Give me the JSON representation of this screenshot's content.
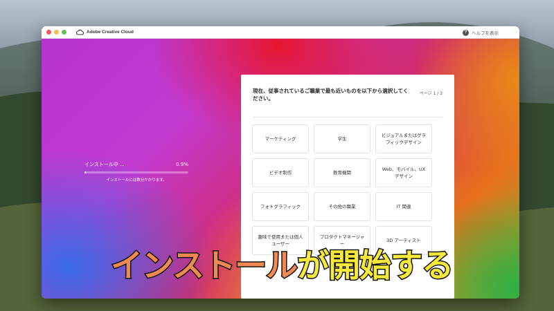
{
  "window": {
    "app_title": "Adobe Creative Cloud",
    "help_label": "ヘルプを表示"
  },
  "install": {
    "status_label": "インストール中 ...",
    "percent": "0.9%",
    "progress_fraction": 0.009,
    "note": "インストールには数分かかります。"
  },
  "survey": {
    "question": "現在、従事されているご職業で最も近いものを以下から選択してください。",
    "page_indicator": "ページ 1 / 3",
    "options": [
      "マーケティング",
      "学生",
      "ビジュアルまたはグラフィックデザイン",
      "ビデオ制作",
      "教育機関",
      "Web、モバイル、UX デザイン",
      "フォトグラフィック",
      "その他の職業",
      "IT 関連",
      "趣味で使用または個人ユーザー",
      "プロダクトマネージャー",
      "3D アーティスト"
    ]
  },
  "caption": {
    "part1": "インストール",
    "part2": "が開始する"
  },
  "colors": {
    "caption_orange": "#f08a52",
    "caption_yellow": "#f7ea3a",
    "close": "#ee5b55",
    "minimize": "#f5bd4f",
    "maximize": "#5fc453"
  }
}
